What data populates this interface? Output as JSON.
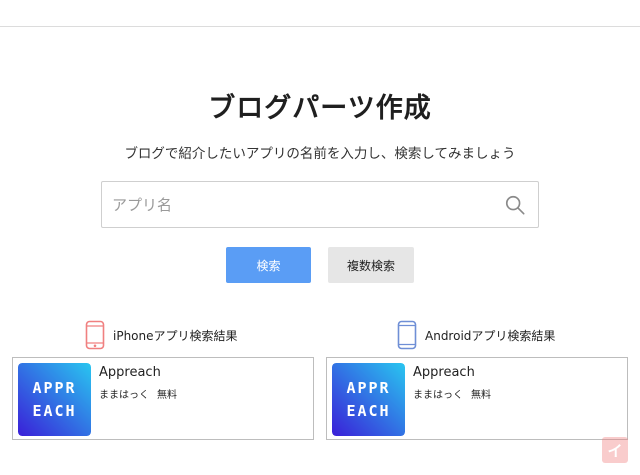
{
  "page": {
    "title": "ブログパーツ作成",
    "subtitle": "ブログで紹介したいアプリの名前を入力し、検索してみましょう"
  },
  "search": {
    "placeholder": "アプリ名",
    "value": "",
    "icon": "search-icon"
  },
  "buttons": {
    "search_label": "検索",
    "multi_search_label": "複数検索",
    "primary_color": "#5a9df5",
    "secondary_color": "#e6e6e6"
  },
  "results": {
    "iphone": {
      "heading": "iPhoneアプリ検索結果",
      "icon": "iphone-icon",
      "icon_color": "#f08080",
      "app": {
        "name": "Appreach",
        "developer": "ままはっく",
        "price": "無料",
        "logo_lines": [
          "APPR",
          "EACH"
        ]
      }
    },
    "android": {
      "heading": "Androidアプリ検索結果",
      "icon": "android-phone-icon",
      "icon_color": "#6f8fd6",
      "app": {
        "name": "Appreach",
        "developer": "ままはっく",
        "price": "無料",
        "logo_lines": [
          "APPR",
          "EACH"
        ]
      }
    }
  },
  "badge": {
    "label": "イ",
    "color": "#ee7878"
  }
}
